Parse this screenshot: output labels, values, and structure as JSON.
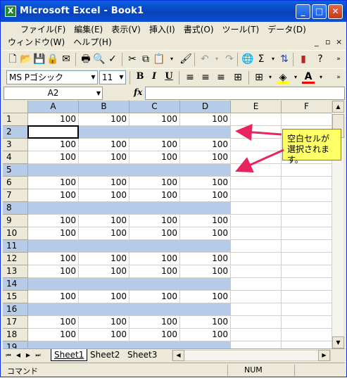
{
  "window": {
    "title": "Microsoft Excel - Book1",
    "app_icon_letter": "X"
  },
  "titlebar_buttons": {
    "minimize": "_",
    "maximize": "□",
    "close": "✕"
  },
  "menu": {
    "row1": [
      "ファイル(F)",
      "編集(E)",
      "表示(V)",
      "挿入(I)",
      "書式(O)",
      "ツール(T)",
      "データ(D)"
    ],
    "row2": [
      "ウィンドウ(W)",
      "ヘルプ(H)"
    ],
    "doc_controls": [
      "_",
      "▫",
      "×"
    ]
  },
  "toolbar2": {
    "font_name": "MS Pゴシック",
    "font_size": "11",
    "bold": "B",
    "italic": "I",
    "underline": "U"
  },
  "formula_bar": {
    "name_box": "A2",
    "fx_label": "fx",
    "formula": ""
  },
  "columns": [
    "A",
    "B",
    "C",
    "D",
    "E",
    "F"
  ],
  "rows": [
    {
      "n": "1",
      "values": [
        "100",
        "100",
        "100",
        "100"
      ]
    },
    {
      "n": "2",
      "values": [
        "",
        "",
        "",
        ""
      ]
    },
    {
      "n": "3",
      "values": [
        "100",
        "100",
        "100",
        "100"
      ]
    },
    {
      "n": "4",
      "values": [
        "100",
        "100",
        "100",
        "100"
      ]
    },
    {
      "n": "5",
      "values": [
        "",
        "",
        "",
        ""
      ]
    },
    {
      "n": "6",
      "values": [
        "100",
        "100",
        "100",
        "100"
      ]
    },
    {
      "n": "7",
      "values": [
        "100",
        "100",
        "100",
        "100"
      ]
    },
    {
      "n": "8",
      "values": [
        "",
        "",
        "",
        ""
      ]
    },
    {
      "n": "9",
      "values": [
        "100",
        "100",
        "100",
        "100"
      ]
    },
    {
      "n": "10",
      "values": [
        "100",
        "100",
        "100",
        "100"
      ]
    },
    {
      "n": "11",
      "values": [
        "",
        "",
        "",
        ""
      ]
    },
    {
      "n": "12",
      "values": [
        "100",
        "100",
        "100",
        "100"
      ]
    },
    {
      "n": "13",
      "values": [
        "100",
        "100",
        "100",
        "100"
      ]
    },
    {
      "n": "14",
      "values": [
        "",
        "",
        "",
        ""
      ]
    },
    {
      "n": "15",
      "values": [
        "100",
        "100",
        "100",
        "100"
      ]
    },
    {
      "n": "16",
      "values": [
        "",
        "",
        "",
        ""
      ]
    },
    {
      "n": "17",
      "values": [
        "100",
        "100",
        "100",
        "100"
      ]
    },
    {
      "n": "18",
      "values": [
        "100",
        "100",
        "100",
        "100"
      ]
    },
    {
      "n": "19",
      "values": [
        "",
        "",
        "",
        ""
      ]
    }
  ],
  "selected_blank_rows": [
    "2",
    "5",
    "8",
    "11",
    "14",
    "16",
    "19"
  ],
  "active_cell": "A2",
  "sheet_tabs": [
    "Sheet1",
    "Sheet2",
    "Sheet3"
  ],
  "active_sheet": "Sheet1",
  "status": {
    "mode": "コマンド",
    "num": "NUM"
  },
  "annotation": {
    "line1": "空白セルが",
    "line2": "選択されます。",
    "arrow_color": "#e8245f",
    "box_color": "#ffff66"
  },
  "colors": {
    "selection": "#b6cbe8",
    "titlebar": "#0a4fd6"
  }
}
